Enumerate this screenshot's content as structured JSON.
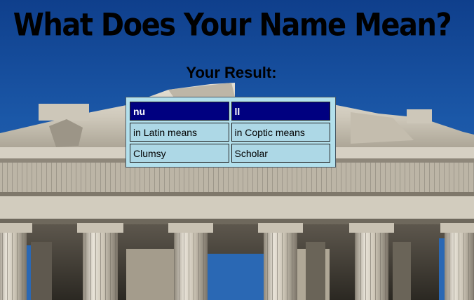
{
  "page": {
    "title": "What Does Your Name Mean?",
    "result_heading": "Your Result:"
  },
  "result_table": {
    "columns": [
      {
        "name": "nu",
        "language_label": "in Latin means",
        "meaning": "Clumsy"
      },
      {
        "name": "ll",
        "language_label": "in Coptic means",
        "meaning": "Scholar"
      }
    ]
  },
  "colors": {
    "sky": "#1b58a8",
    "header_row_bg": "#000080",
    "cell_bg": "#add8e6",
    "marble": "#d9d4c8"
  },
  "background": {
    "image": "parthenon-ruins"
  }
}
